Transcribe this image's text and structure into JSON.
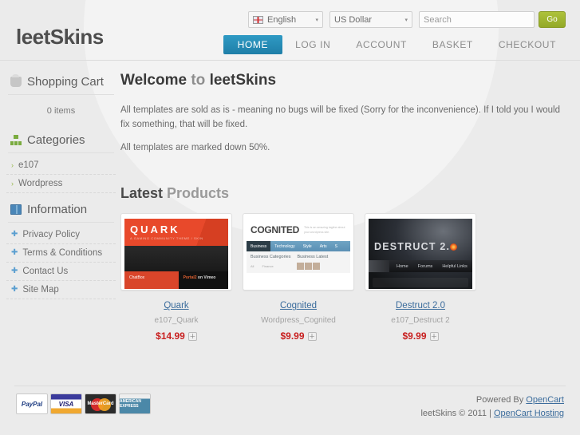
{
  "site": {
    "logo": "leetSkins"
  },
  "topbar": {
    "language": {
      "label": "English",
      "icon": "uk-flag-icon",
      "caret": "▾"
    },
    "currency": {
      "label": "US Dollar",
      "caret": "▾"
    },
    "search": {
      "value": "",
      "placeholder": "Search",
      "button_label": "Go"
    }
  },
  "nav": {
    "items": [
      {
        "label": "HOME",
        "active": true
      },
      {
        "label": "LOG IN",
        "active": false
      },
      {
        "label": "ACCOUNT",
        "active": false
      },
      {
        "label": "BASKET",
        "active": false
      },
      {
        "label": "CHECKOUT",
        "active": false
      }
    ]
  },
  "sidebar": {
    "cart": {
      "title": "Shopping Cart",
      "icon": "cart-icon",
      "empty_text": "0 items"
    },
    "categories": {
      "title": "Categories",
      "icon": "category-tree-icon",
      "items": [
        {
          "label": "e107",
          "bullet": "›"
        },
        {
          "label": "Wordpress",
          "bullet": "›"
        }
      ]
    },
    "information": {
      "title": "Information",
      "icon": "book-icon",
      "items": [
        {
          "label": "Privacy Policy",
          "bullet": "✚"
        },
        {
          "label": "Terms & Conditions",
          "bullet": "✚"
        },
        {
          "label": "Contact Us",
          "bullet": "✚"
        },
        {
          "label": "Site Map",
          "bullet": "✚"
        }
      ]
    }
  },
  "main": {
    "welcome": {
      "bold": "Welcome",
      "light": " to ",
      "bold2": "leetSkins"
    },
    "paragraphs": [
      "All templates are sold as is - meaning no bugs will be fixed (Sorry for the inconvenience).  If I told you I would fix something, that will be fixed.",
      "All templates are marked down 50%."
    ],
    "latest": {
      "bold": "Latest",
      "light": " Products"
    },
    "products": [
      {
        "name": "Quark",
        "model": "e107_Quark",
        "price": "$14.99",
        "add_label": "＋",
        "thumb": {
          "kind": "quark",
          "logo": "QUARK",
          "tagline": "A GAMING COMMUNITY THEME / SKIN",
          "chat_label": "ChatBox",
          "feature_a": "Portal2",
          "feature_b": " on Vimeo"
        }
      },
      {
        "name": "Cognited",
        "model": "Wordpress_Cognited",
        "price": "$9.99",
        "add_label": "＋",
        "thumb": {
          "kind": "cognited",
          "logo": "COGNITED",
          "tagline": "This is an amazing tagline about your wordpress site.",
          "nav": [
            "Business",
            "Technology",
            "Style",
            "Arts",
            "S"
          ],
          "col1_title": "Business Categories",
          "col2_title": "Business Latest",
          "col1_items": [
            "All",
            "Finance"
          ]
        }
      },
      {
        "name": "Destruct 2.0",
        "model": "e107_Destruct 2",
        "price": "$9.99",
        "add_label": "＋",
        "thumb": {
          "kind": "destruct",
          "logo": "DESTRUCT 2.",
          "nav": [
            "Home",
            "Forums",
            "Helpful Links"
          ]
        }
      }
    ]
  },
  "footer": {
    "payments": [
      {
        "name": "paypal-icon",
        "label": "PayPal"
      },
      {
        "name": "visa-icon",
        "label": "VISA"
      },
      {
        "name": "mastercard-icon",
        "label": "MasterCard"
      },
      {
        "name": "amex-icon",
        "label": "AMERICAN EXPRESS"
      }
    ],
    "powered_prefix": "Powered By ",
    "powered_link": "OpenCart",
    "copyright": "leetSkins © 2011 | ",
    "hosting_link": "OpenCart Hosting"
  },
  "colors": {
    "accent_blue": "#2f9ac4",
    "link_blue": "#3b6c9c",
    "price_red": "#c82020",
    "go_green": "#a3b832",
    "page_bg": "#ebebeb"
  }
}
